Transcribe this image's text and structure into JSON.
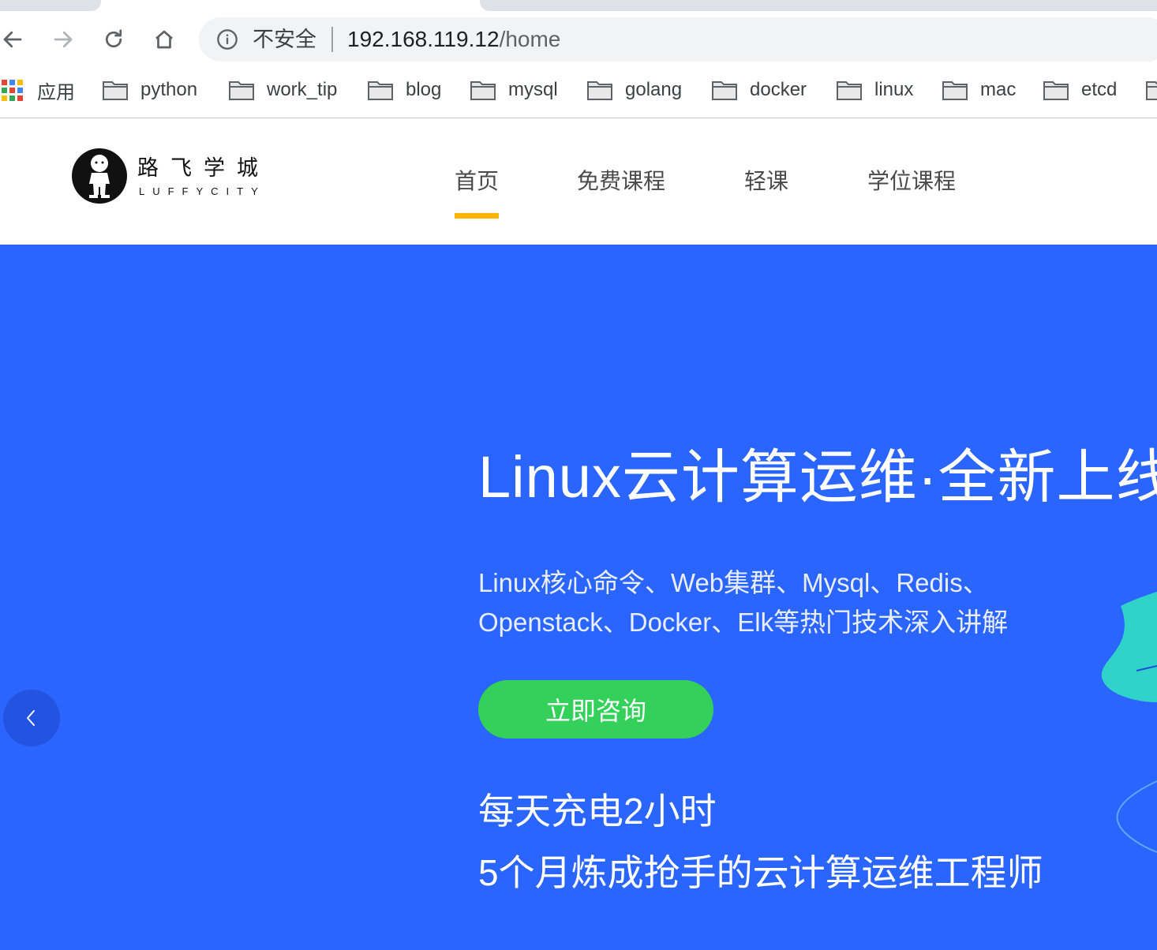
{
  "browser": {
    "security_label": "不安全",
    "url_host": "192.168.119.12",
    "url_path": "/home",
    "bookmarks": [
      {
        "label": "应用",
        "icon": "apps-grid-icon"
      },
      {
        "label": "python",
        "icon": "folder-icon"
      },
      {
        "label": "work_tip",
        "icon": "folder-icon"
      },
      {
        "label": "blog",
        "icon": "folder-icon"
      },
      {
        "label": "mysql",
        "icon": "folder-icon"
      },
      {
        "label": "golang",
        "icon": "folder-icon"
      },
      {
        "label": "docker",
        "icon": "folder-icon"
      },
      {
        "label": "linux",
        "icon": "folder-icon"
      },
      {
        "label": "mac",
        "icon": "folder-icon"
      },
      {
        "label": "etcd",
        "icon": "folder-icon"
      }
    ]
  },
  "site": {
    "logo_cn": "路飞学城",
    "logo_en": "LUFFYCITY",
    "nav": [
      {
        "label": "首页",
        "active": true
      },
      {
        "label": "免费课程",
        "active": false
      },
      {
        "label": "轻课",
        "active": false
      },
      {
        "label": "学位课程",
        "active": false
      }
    ],
    "accent_color": "#ffb400"
  },
  "hero": {
    "title": "Linux云计算运维·全新上线",
    "subtitle_lines": [
      "Linux核心命令、Web集群、Mysql、Redis、",
      "Openstack、Docker、Elk等热门技术深入讲解"
    ],
    "cta_label": "立即咨询",
    "tagline_lines": [
      "每天充电2小时",
      "5个月炼成抢手的云计算运维工程师"
    ],
    "background_color": "#2b65ff",
    "cta_color": "#33d15a"
  }
}
